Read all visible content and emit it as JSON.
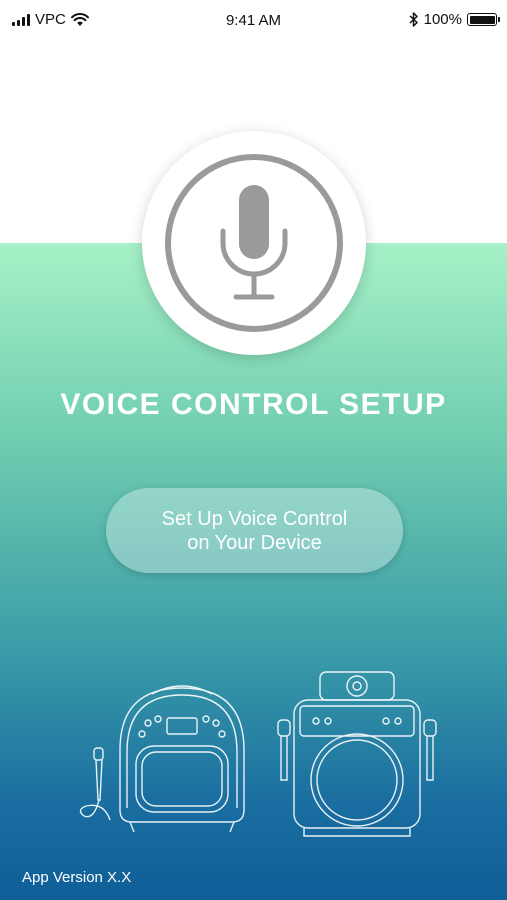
{
  "status_bar": {
    "carrier": "VPC",
    "time": "9:41 AM",
    "battery_percent": "100%",
    "icons": [
      "signal-icon",
      "wifi-icon",
      "bluetooth-icon",
      "battery-icon"
    ]
  },
  "hero": {
    "icon": "microphone-icon",
    "title": "VOICE CONTROL SETUP"
  },
  "setup_button": {
    "line1": "Set Up Voice Control",
    "line2": "on Your Device"
  },
  "devices": {
    "icons": [
      "karaoke-machine-round-icon",
      "karaoke-machine-speaker-icon"
    ]
  },
  "footer": {
    "app_version": "App Version X.X"
  },
  "colors": {
    "gradient_top": "#a6f1c7",
    "gradient_bottom": "#0f5e98",
    "mic_gray": "#9a9a9a"
  }
}
